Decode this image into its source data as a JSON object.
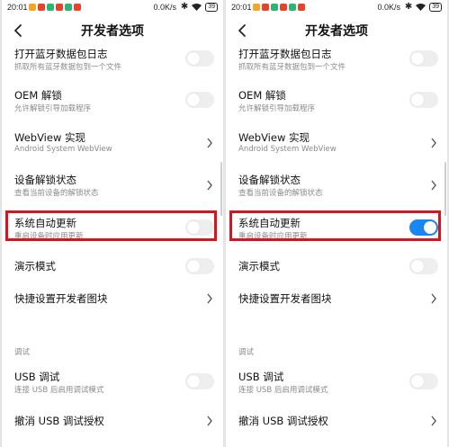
{
  "status": {
    "time": "20:01",
    "speed": "0.0K/s",
    "battery": "39"
  },
  "header": {
    "title": "开发者选项"
  },
  "settings": {
    "bt_log": {
      "title": "打开蓝牙数据包日志",
      "sub": "抓取所有蓝牙数据包到一个文件"
    },
    "oem": {
      "title": "OEM 解锁",
      "sub": "允许解锁引导加载程序"
    },
    "webview": {
      "title": "WebView 实现",
      "sub": "Android System WebView"
    },
    "unlock_state": {
      "title": "设备解锁状态",
      "sub": "查看当前设备的解锁状态"
    },
    "auto_update": {
      "title": "系统自动更新",
      "sub": "重启设备时应用更新"
    },
    "demo": {
      "title": "演示模式"
    },
    "quick_tiles": {
      "title": "快捷设置开发者图块"
    },
    "debug_section": "调试",
    "usb_debug": {
      "title": "USB 调试",
      "sub": "连接 USB 后启用调试模式"
    },
    "revoke_usb": {
      "title": "撤消 USB 调试授权"
    }
  },
  "screens": {
    "left": {
      "auto_update_on": false
    },
    "right": {
      "auto_update_on": true
    }
  },
  "colors": {
    "toggle_on": "#1a86f0",
    "highlight": "#d9141e"
  }
}
